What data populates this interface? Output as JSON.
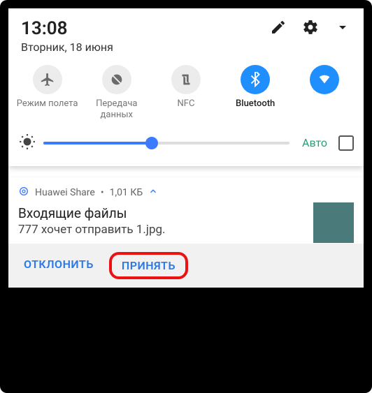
{
  "status": {
    "time": "13:08",
    "date": "Вторник, 18 июня"
  },
  "toggles": [
    {
      "label": "Режим полета",
      "on": false
    },
    {
      "label": "Передача данных",
      "on": false
    },
    {
      "label": "NFC",
      "on": false
    },
    {
      "label": "Bluetooth",
      "on": true
    },
    {
      "label": "",
      "on": true
    }
  ],
  "brightness": {
    "auto_label": "Авто",
    "value_percent": 44
  },
  "notification": {
    "app": "Huawei Share",
    "size": "1,01 КБ",
    "title": "Входящие файлы",
    "text": "777 хочет отправить 1.jpg.",
    "actions": {
      "decline": "ОТКЛОНИТЬ",
      "accept": "ПРИНЯТЬ"
    }
  }
}
